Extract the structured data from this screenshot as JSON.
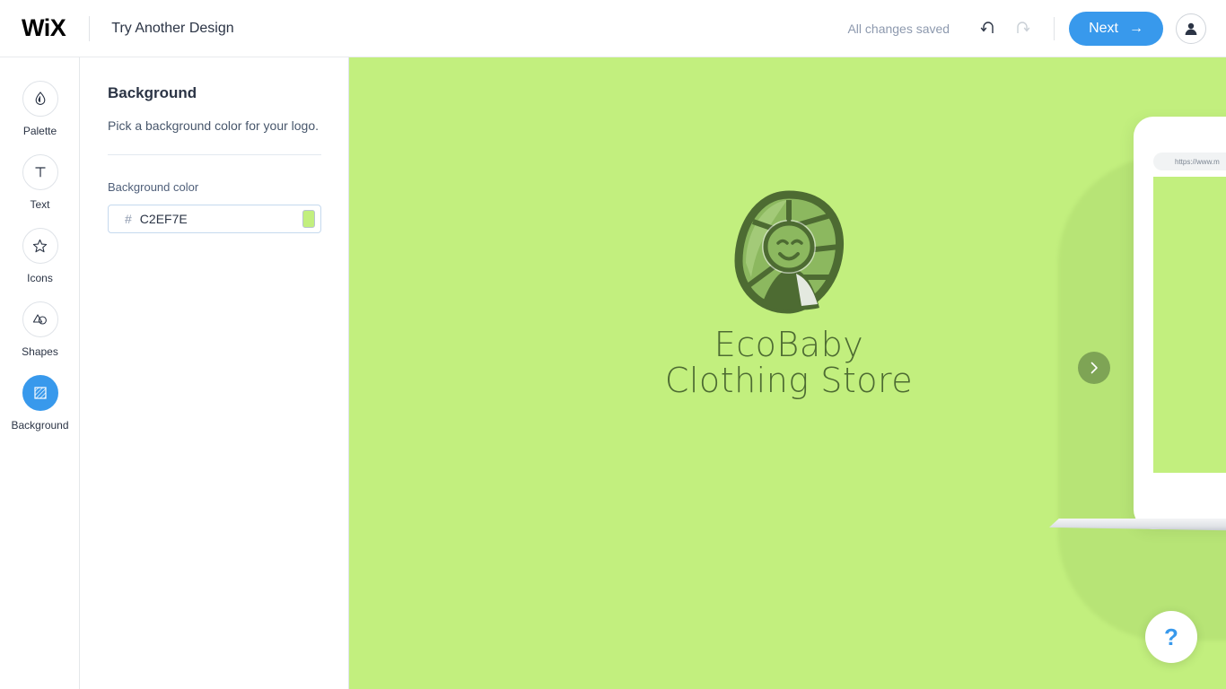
{
  "header": {
    "brand": "WiX",
    "title": "Try Another Design",
    "save_status": "All changes saved",
    "undo_icon": "undo-icon",
    "redo_icon": "redo-icon",
    "next_label": "Next",
    "next_arrow": "→",
    "avatar_icon": "user-avatar-icon",
    "accent_color": "#3899ec"
  },
  "sidebar": {
    "items": [
      {
        "label": "Palette",
        "icon": "droplet-icon",
        "active": false
      },
      {
        "label": "Text",
        "icon": "text-t-icon",
        "active": false
      },
      {
        "label": "Icons",
        "icon": "star-icon",
        "active": false
      },
      {
        "label": "Shapes",
        "icon": "shapes-icon",
        "active": false
      },
      {
        "label": "Background",
        "icon": "background-hatch-icon",
        "active": true
      }
    ]
  },
  "panel": {
    "title": "Background",
    "subtitle": "Pick a background color for your logo.",
    "field_label": "Background color",
    "hash_prefix": "#",
    "color_value": "C2EF7E",
    "swatch_color": "#C2EF7E"
  },
  "canvas": {
    "background_color": "#C2EF7E",
    "logo": {
      "icon": "leaf-baby-logo-icon",
      "name_line1": "EcoBaby",
      "name_line2": "Clothing Store",
      "text_color": "#4d6b32"
    },
    "device": {
      "url_text": "https://www.m",
      "screen_color": "#C2EF7E"
    },
    "next_design_arrow": "chevron-right-icon",
    "help_label": "?"
  }
}
